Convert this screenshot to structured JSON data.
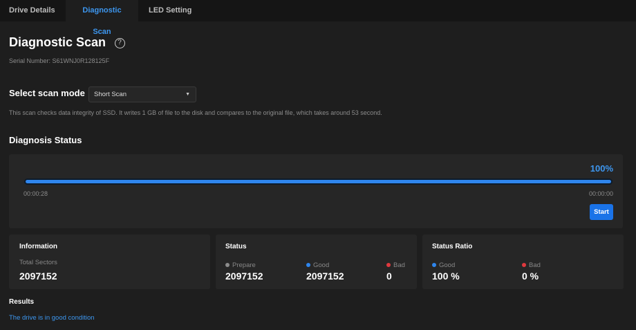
{
  "tabs": [
    {
      "label": "Drive Details"
    },
    {
      "label": "Diagnostic Scan"
    },
    {
      "label": "LED Setting"
    }
  ],
  "title": "Diagnostic Scan",
  "help_icon": "?",
  "serial": "Serial Number: S61WNJ0R128125F",
  "scan_mode": {
    "label": "Select scan mode",
    "selected": "Short Scan",
    "description": "This scan checks data integrity of SSD. It writes 1 GB of file to the disk and compares to the original file, which takes around 53 second."
  },
  "status_title": "Diagnosis Status",
  "progress": {
    "percent_label": "100%",
    "percent": 100,
    "elapsed": "00:00:28",
    "remaining": "00:00:00",
    "start": "Start"
  },
  "information": {
    "title": "Information",
    "label": "Total Sectors",
    "value": "2097152"
  },
  "status": {
    "title": "Status",
    "prepare_label": "Prepare",
    "prepare": "2097152",
    "good_label": "Good",
    "good": "2097152",
    "bad_label": "Bad",
    "bad": "0"
  },
  "ratio": {
    "title": "Status Ratio",
    "good_label": "Good",
    "good": "100 %",
    "bad_label": "Bad",
    "bad": "0 %"
  },
  "results": {
    "title": "Results",
    "text": "The drive is in good condition"
  },
  "colors": {
    "accent": "#3d97f0",
    "good": "#2f86ee",
    "bad": "#e0393e",
    "prepare": "#8c8c8c"
  }
}
